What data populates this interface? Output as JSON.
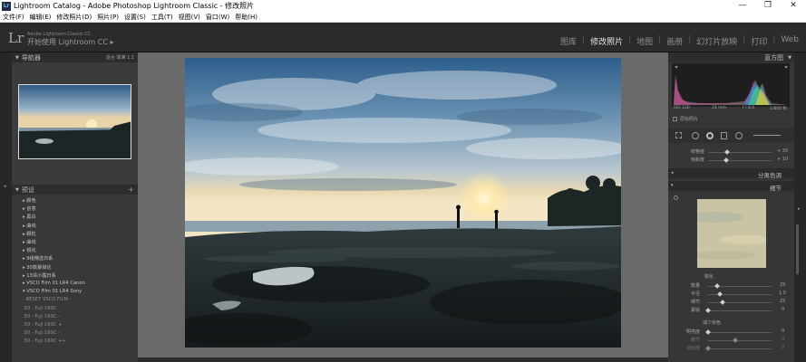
{
  "window": {
    "icon": "Lr",
    "title": "Lightroom Catalog - Adobe Photoshop Lightroom Classic - 修改照片",
    "controls": [
      "—",
      "❐",
      "✕"
    ]
  },
  "menu": [
    "文件(F)",
    "编辑(E)",
    "修改照片(D)",
    "照片(P)",
    "设置(S)",
    "工具(T)",
    "视图(V)",
    "窗口(W)",
    "帮助(H)"
  ],
  "identity": {
    "logo": "Lr",
    "catalog_line1": "Adobe Lightroom Classic CC",
    "catalog_line2": "开始使用 Lightroom CC",
    "arrow": "▸",
    "modules": [
      "图库",
      "修改照片",
      "地图",
      "画册",
      "幻灯片放映",
      "打印",
      "Web"
    ],
    "active_module": "修改照片",
    "sep": "|"
  },
  "left_panel": {
    "navigator": {
      "title": "导航器",
      "options": "适合  填满  1:1"
    },
    "presets": {
      "title": "预设",
      "add": "+",
      "items": [
        {
          "label": "▸ 颜色",
          "dim": false
        },
        {
          "label": "▸ 创意",
          "dim": false
        },
        {
          "label": "▸ 黑白",
          "dim": false
        },
        {
          "label": "▸ 曲线",
          "dim": false
        },
        {
          "label": "▸ 颗粒",
          "dim": false
        },
        {
          "label": "▸ 曲线",
          "dim": false
        },
        {
          "label": "▸ 锐化",
          "dim": false
        },
        {
          "label": "▸ 9组精选日系",
          "dim": false
        },
        {
          "label": "▸ 30款暴掉论",
          "dim": false
        },
        {
          "label": "▸ 13清小露日系",
          "dim": false
        },
        {
          "label": "▸ VSCO Film 01 LR4 Canon",
          "dim": false
        },
        {
          "label": "▾ VSCO Film 01 LR4 Sony",
          "dim": false
        },
        {
          "label": "   - RESET VSCO FILM -",
          "dim": true
        },
        {
          "label": "   .50 - Fuji 160C",
          "dim": true
        },
        {
          "label": "   .50 - Fuji 160C -",
          "dim": true
        },
        {
          "label": "   .50 - Fuji 160C +",
          "dim": true
        },
        {
          "label": "   .50 - Fuji 160C -",
          "dim": true
        },
        {
          "label": "   .50 - Fuji 160C ++",
          "dim": true
        }
      ]
    }
  },
  "right_panel": {
    "histogram": {
      "title": "直方图",
      "info_left": "ISO 100",
      "info_mid": "24 mm",
      "info_right": "f / 8.0",
      "info_far": "1/800 秒",
      "original": "原始照片"
    },
    "basic": {
      "vibrance_label": "鲜艳度",
      "vibrance_value": "+ 30",
      "saturation_label": "饱和度",
      "saturation_value": "+ 10"
    },
    "sections": {
      "split_toning": "分离色调",
      "detail": "细节"
    },
    "sharpening": {
      "title": "锐化",
      "amount_label": "数量",
      "amount_value": "25",
      "radius_label": "半径",
      "radius_value": "1.0",
      "detail_label": "细节",
      "detail_value": "25",
      "masking_label": "蒙版",
      "masking_value": "0"
    },
    "noise": {
      "title": "减少杂色",
      "luminance_label": "明亮度",
      "luminance_value": "0",
      "detail_label": "细节",
      "detail_value": "0",
      "contrast_label": "对比度",
      "contrast_value": "0"
    }
  },
  "colors": {
    "bg": "#262626",
    "panel": "#3b3b3b",
    "active_module": "#e6e6e6"
  }
}
